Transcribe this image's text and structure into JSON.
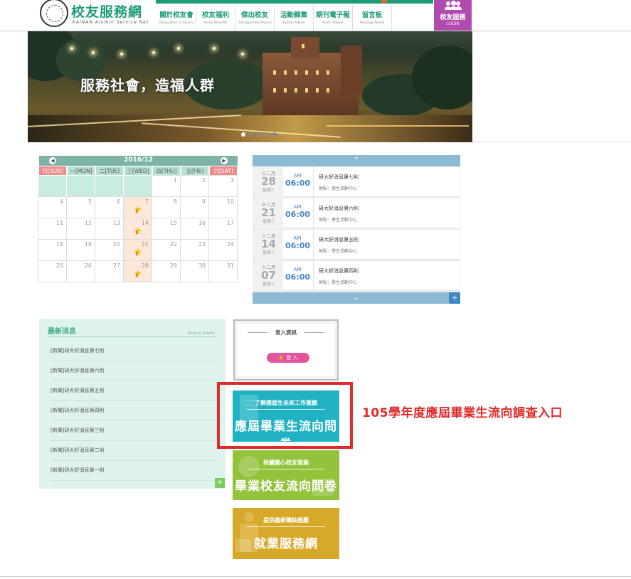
{
  "header": {
    "site_name": "校友服務網",
    "site_en": "KAINAN Alumni Service Net",
    "nav": [
      {
        "label": "關於校友會",
        "en": "Association of Alumni"
      },
      {
        "label": "校友福利",
        "en": "Alumi Benefits"
      },
      {
        "label": "傑出校友",
        "en": "Distinguished Alumni"
      },
      {
        "label": "活動錦集",
        "en": "Events Album"
      },
      {
        "label": "期刊電子報",
        "en": "Alumi ePaper"
      },
      {
        "label": "留言板",
        "en": "Message Board"
      }
    ],
    "login": {
      "label": "校友服務",
      "en": "LOGIN"
    }
  },
  "banner": {
    "slogan": "服務社會，造福人群",
    "slides": 5,
    "active_slide": 1
  },
  "calendar": {
    "title": "2016/12",
    "days": [
      "日[SUN]",
      "一[MON]",
      "二[TUE]",
      "三[WED]",
      "四[THU]",
      "五[FRI]",
      "六[SAT]"
    ],
    "weeks": [
      [
        "",
        "",
        "",
        "",
        "1",
        "2",
        "3"
      ],
      [
        "4",
        "5",
        "6",
        "7",
        "8",
        "9",
        "10"
      ],
      [
        "11",
        "12",
        "13",
        "14",
        "15",
        "16",
        "17"
      ],
      [
        "18",
        "19",
        "20",
        "21",
        "22",
        "23",
        "24"
      ],
      [
        "25",
        "26",
        "27",
        "28",
        "29",
        "30",
        "31"
      ]
    ],
    "event_days": [
      "7",
      "14",
      "21",
      "28"
    ],
    "event_badge": "1"
  },
  "events": {
    "items": [
      {
        "month": "十二月",
        "day": "28",
        "weekday": "星期三",
        "ampm": "AM",
        "time": "06:00",
        "title": "研大好消息第七則",
        "location": "地點：學生活動中心"
      },
      {
        "month": "十二月",
        "day": "21",
        "weekday": "星期三",
        "ampm": "AM",
        "time": "06:00",
        "title": "研大好消息第六則",
        "location": "地點：學生活動中心"
      },
      {
        "month": "十二月",
        "day": "14",
        "weekday": "星期三",
        "ampm": "AM",
        "time": "06:00",
        "title": "研大好消息第五則",
        "location": "地點：學生活動中心"
      },
      {
        "month": "十二月",
        "day": "07",
        "weekday": "星期三",
        "ampm": "AM",
        "time": "06:00",
        "title": "研大好消息第四則",
        "location": "地點：學生活動中心"
      }
    ],
    "more": "+"
  },
  "news": {
    "title": "最新消息",
    "title_en": "News & Events",
    "items": [
      "[新聞]研大好消息第七則",
      "[新聞]研大好消息第六則",
      "[新聞]研大好消息第五則",
      "[新聞]研大好消息第四則",
      "[新聞]研大好消息第三則",
      "[新聞]研大好消息第二則",
      "[新聞]研大好消息第一則"
    ],
    "more": "+"
  },
  "login_box": {
    "title": "登入資訊",
    "button": "登 入"
  },
  "surveys": [
    {
      "subtitle": "了解應屆生未來工作意願",
      "title": "應屆畢業生流向問卷",
      "color": "#20b2c3"
    },
    {
      "subtitle": "持續關心校友發展",
      "title": "畢業校友流向問卷",
      "color": "#93c33a"
    },
    {
      "subtitle": "提供最新職缺推薦",
      "title": "就業服務網",
      "color": "#d8a929"
    }
  ],
  "callout": "105學年度應屆畢業生流向調查入口",
  "colors": {
    "brand": "#1d9c78",
    "login": "#b04bb0",
    "highlight": "#e02b2b",
    "event_blue": "#3f86c7"
  }
}
